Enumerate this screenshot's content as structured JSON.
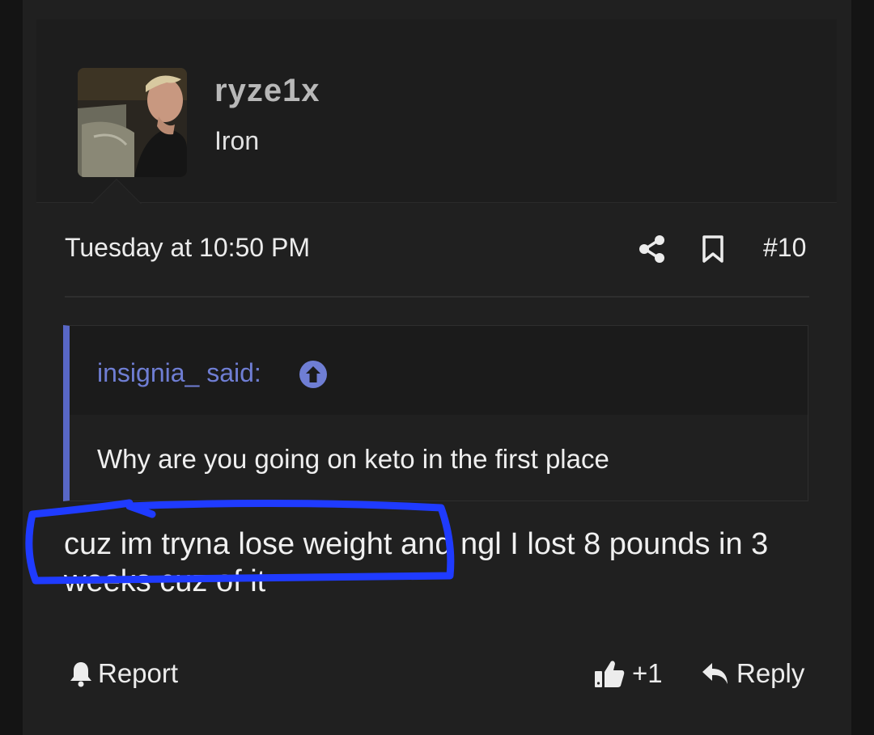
{
  "post": {
    "author": {
      "username": "ryze1x",
      "title": "Iron",
      "avatar_icon": "user-photo-avatar"
    },
    "date": "Tuesday at 10:50 PM",
    "number": "#10",
    "share_icon": "share-icon",
    "bookmark_icon": "bookmark-icon",
    "quote": {
      "author_label": "insignia_ said:",
      "jump_icon": "arrow-up-circle-icon",
      "text": "Why are you going on keto in the first place"
    },
    "message": "cuz im tryna lose weight and ngl I lost 8 pounds in 3 weeks cuz of it",
    "actions": {
      "report_label": "Report",
      "report_icon": "bell-icon",
      "like_count": "+1",
      "like_icon": "thumbs-up-icon",
      "reply_label": "Reply",
      "reply_icon": "reply-arrow-icon"
    }
  },
  "colors": {
    "background": "#141414",
    "card": "#202020",
    "quote_accent": "#5867c6",
    "highlight_scribble": "#1f3bff"
  }
}
